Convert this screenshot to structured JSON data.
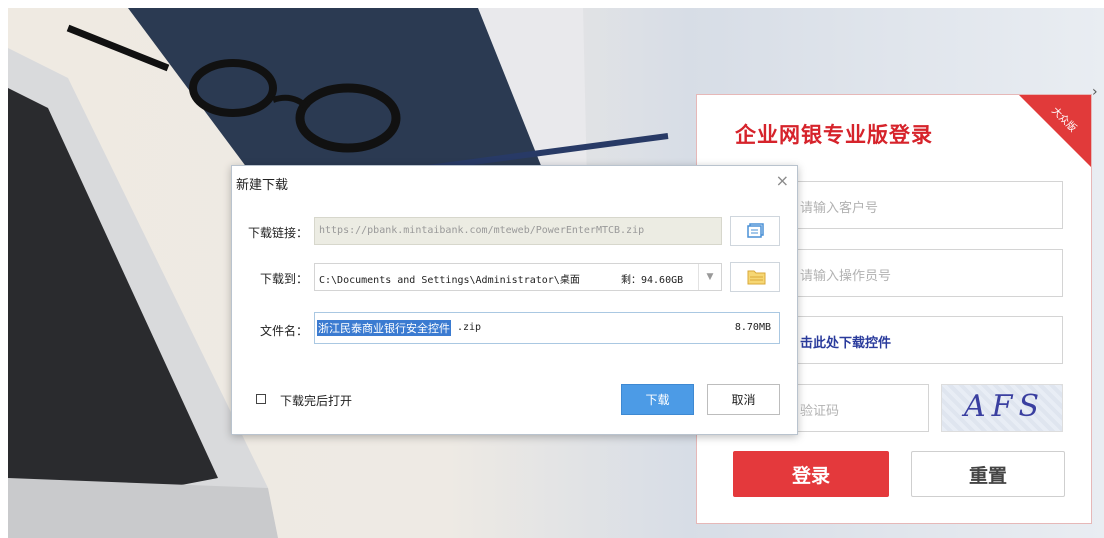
{
  "login": {
    "title": "企业网银专业版登录",
    "ribbon": "大众版",
    "customer_placeholder": "请输入客户号",
    "operator_placeholder": "请输入操作员号",
    "download_control_link": "击此处下载控件",
    "captcha_placeholder": "验证码",
    "captcha_text": "AFS",
    "login_button": "登录",
    "reset_button": "重置",
    "close_glyph": "›"
  },
  "dialog": {
    "title": "新建下载",
    "close_glyph": "×",
    "url_label": "下载链接：",
    "url_value": "https://pbank.mintaibank.com/mteweb/PowerEnterMTCB.zip",
    "save_to_label": "下载到：",
    "save_to_value": "C:\\Documents and Settings\\Administrator\\桌面",
    "free_space": "剩：94.60GB",
    "filename_label": "文件名：",
    "filename_selected": "浙江民泰商业银行安全控件",
    "filename_ext": ".zip",
    "file_size": "8.70MB",
    "open_after_label": "下载完后打开",
    "download_button": "下载",
    "cancel_button": "取消"
  }
}
